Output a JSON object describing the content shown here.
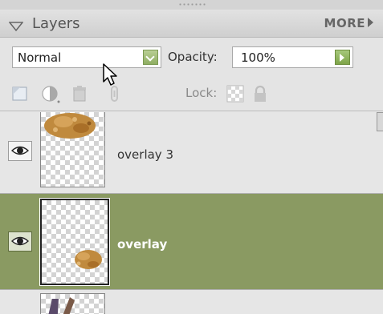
{
  "panel": {
    "title": "Layers",
    "more_label": "MORE"
  },
  "blend": {
    "mode": "Normal"
  },
  "opacity": {
    "label": "Opacity:",
    "value": "100%"
  },
  "lock": {
    "label": "Lock:"
  },
  "layers": [
    {
      "name": "overlay 3",
      "visible": true,
      "selected": false
    },
    {
      "name": "overlay",
      "visible": true,
      "selected": true
    },
    {
      "name": "",
      "visible": false,
      "selected": false
    }
  ],
  "colors": {
    "selected_layer": "#8a9a62",
    "accent_button": "#8fae62"
  },
  "icons": [
    "collapse-triangle-icon",
    "more-arrow-icon",
    "dropdown-arrow-icon",
    "arrow-right-icon",
    "new-layer-icon",
    "adjustment-layer-icon",
    "delete-layer-icon",
    "link-icon",
    "lock-transparent-icon",
    "lock-icon",
    "eye-icon",
    "mouse-cursor-icon"
  ]
}
